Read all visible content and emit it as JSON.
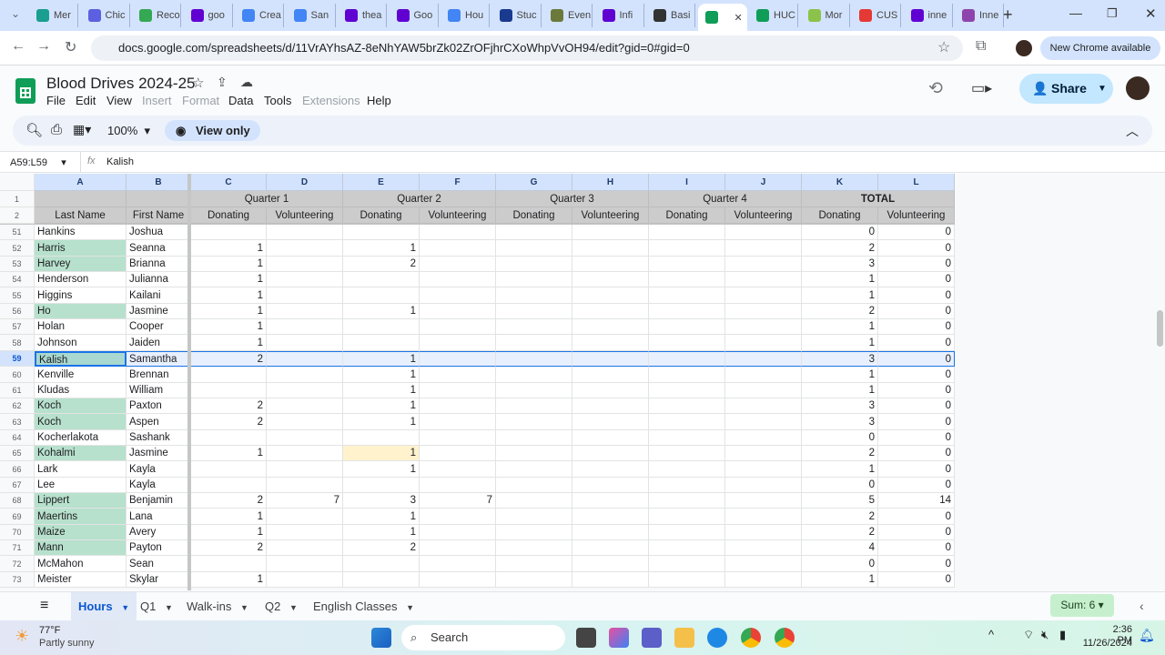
{
  "browser": {
    "tabs": [
      {
        "title": "Mer",
        "color": "#1a9e8f"
      },
      {
        "title": "Chic",
        "color": "#5b5fe0"
      },
      {
        "title": "Reco",
        "color": "#34a853"
      },
      {
        "title": "goo",
        "color": "#6001d2"
      },
      {
        "title": "Crea",
        "color": "#4285f4"
      },
      {
        "title": "San",
        "color": "#4285f4"
      },
      {
        "title": "thea",
        "color": "#6001d2"
      },
      {
        "title": "Goo",
        "color": "#6001d2"
      },
      {
        "title": "Hou",
        "color": "#4285f4"
      },
      {
        "title": "Stuc",
        "color": "#1a3a8f"
      },
      {
        "title": "Even",
        "color": "#6b7a3a"
      },
      {
        "title": "Infi",
        "color": "#6001d2"
      },
      {
        "title": "Basi",
        "color": "#333333"
      },
      {
        "title": "",
        "color": "#0f9d58",
        "active": true
      },
      {
        "title": "HUC",
        "color": "#0f9d58"
      },
      {
        "title": "Mor",
        "color": "#8bc34a"
      },
      {
        "title": "CUS",
        "color": "#e53935"
      },
      {
        "title": "inne",
        "color": "#6001d2"
      },
      {
        "title": "Inne",
        "color": "#8e44ad"
      }
    ],
    "url": "docs.google.com/spreadsheets/d/11VrAYhsAZ-8eNhYAW5brZk02ZrOFjhrCXoWhpVvOH94/edit?gid=0#gid=0",
    "new_chrome": "New Chrome available"
  },
  "sheet": {
    "title": "Blood Drives 2024-25",
    "menus": [
      {
        "label": "File",
        "disabled": false
      },
      {
        "label": "Edit",
        "disabled": false
      },
      {
        "label": "View",
        "disabled": false
      },
      {
        "label": "Insert",
        "disabled": true
      },
      {
        "label": "Format",
        "disabled": true
      },
      {
        "label": "Data",
        "disabled": false
      },
      {
        "label": "Tools",
        "disabled": false
      },
      {
        "label": "Extensions",
        "disabled": true
      },
      {
        "label": "Help",
        "disabled": false
      }
    ],
    "share": "Share",
    "zoom": "100%",
    "view_only": "View only",
    "name_box": "A59:L59",
    "formula_value": "Kalish",
    "columns": [
      "A",
      "B",
      "C",
      "D",
      "E",
      "F",
      "G",
      "H",
      "I",
      "J",
      "K",
      "L"
    ],
    "header_row1": {
      "quarters": [
        "Quarter 1",
        "Quarter 2",
        "Quarter 3",
        "Quarter 4",
        "TOTAL"
      ]
    },
    "header_row2": [
      "Last Name",
      "First Name",
      "Donating",
      "Volunteering",
      "Donating",
      "Volunteering",
      "Donating",
      "Volunteering",
      "Donating",
      "Volunteering",
      "Donating",
      "Volunteering"
    ],
    "highlight_green": "#b7e1cd",
    "highlight_yellow": "#fff2cc",
    "selected_row": 59,
    "rows": [
      {
        "n": "51",
        "c": [
          "Hankins",
          "Joshua",
          "",
          "",
          "",
          "",
          "",
          "",
          "",
          "",
          "0",
          "0"
        ]
      },
      {
        "n": "52",
        "c": [
          "Harris",
          "Seanna",
          "1",
          "",
          "1",
          "",
          "",
          "",
          "",
          "",
          "2",
          "0"
        ],
        "g": true
      },
      {
        "n": "53",
        "c": [
          "Harvey",
          "Brianna",
          "1",
          "",
          "2",
          "",
          "",
          "",
          "",
          "",
          "3",
          "0"
        ],
        "g": true
      },
      {
        "n": "54",
        "c": [
          "Henderson",
          "Julianna",
          "1",
          "",
          "",
          "",
          "",
          "",
          "",
          "",
          "1",
          "0"
        ]
      },
      {
        "n": "55",
        "c": [
          "Higgins",
          "Kailani",
          "1",
          "",
          "",
          "",
          "",
          "",
          "",
          "",
          "1",
          "0"
        ]
      },
      {
        "n": "56",
        "c": [
          "Ho",
          "Jasmine",
          "1",
          "",
          "1",
          "",
          "",
          "",
          "",
          "",
          "2",
          "0"
        ],
        "g": true
      },
      {
        "n": "57",
        "c": [
          "Holan",
          "Cooper",
          "1",
          "",
          "",
          "",
          "",
          "",
          "",
          "",
          "1",
          "0"
        ]
      },
      {
        "n": "58",
        "c": [
          "Johnson",
          "Jaiden",
          "1",
          "",
          "",
          "",
          "",
          "",
          "",
          "",
          "1",
          "0"
        ]
      },
      {
        "n": "59",
        "c": [
          "Kalish",
          "Samantha",
          "2",
          "",
          "1",
          "",
          "",
          "",
          "",
          "",
          "3",
          "0"
        ],
        "g": true
      },
      {
        "n": "60",
        "c": [
          "Kenville",
          "Brennan",
          "",
          "",
          "1",
          "",
          "",
          "",
          "",
          "",
          "1",
          "0"
        ]
      },
      {
        "n": "61",
        "c": [
          "Kludas",
          "William",
          "",
          "",
          "1",
          "",
          "",
          "",
          "",
          "",
          "1",
          "0"
        ]
      },
      {
        "n": "62",
        "c": [
          "Koch",
          "Paxton",
          "2",
          "",
          "1",
          "",
          "",
          "",
          "",
          "",
          "3",
          "0"
        ],
        "g": true
      },
      {
        "n": "63",
        "c": [
          "Koch",
          "Aspen",
          "2",
          "",
          "1",
          "",
          "",
          "",
          "",
          "",
          "3",
          "0"
        ],
        "g": true
      },
      {
        "n": "64",
        "c": [
          "Kocherlakota",
          "Sashank",
          "",
          "",
          "",
          "",
          "",
          "",
          "",
          "",
          "0",
          "0"
        ]
      },
      {
        "n": "65",
        "c": [
          "Kohalmi",
          "Jasmine",
          "1",
          "",
          "1",
          "",
          "",
          "",
          "",
          "",
          "2",
          "0"
        ],
        "g": true,
        "y": 4
      },
      {
        "n": "66",
        "c": [
          "Lark",
          "Kayla",
          "",
          "",
          "1",
          "",
          "",
          "",
          "",
          "",
          "1",
          "0"
        ]
      },
      {
        "n": "67",
        "c": [
          "Lee",
          "Kayla",
          "",
          "",
          "",
          "",
          "",
          "",
          "",
          "",
          "0",
          "0"
        ]
      },
      {
        "n": "68",
        "c": [
          "Lippert",
          "Benjamin",
          "2",
          "7",
          "3",
          "7",
          "",
          "",
          "",
          "",
          "5",
          "14"
        ],
        "g": true
      },
      {
        "n": "69",
        "c": [
          "Maertins",
          "Lana",
          "1",
          "",
          "1",
          "",
          "",
          "",
          "",
          "",
          "2",
          "0"
        ],
        "g": true
      },
      {
        "n": "70",
        "c": [
          "Maize",
          "Avery",
          "1",
          "",
          "1",
          "",
          "",
          "",
          "",
          "",
          "2",
          "0"
        ],
        "g": true
      },
      {
        "n": "71",
        "c": [
          "Mann",
          "Payton",
          "2",
          "",
          "2",
          "",
          "",
          "",
          "",
          "",
          "4",
          "0"
        ],
        "g": true
      },
      {
        "n": "72",
        "c": [
          "McMahon",
          "Sean",
          "",
          "",
          "",
          "",
          "",
          "",
          "",
          "",
          "0",
          "0"
        ]
      },
      {
        "n": "73",
        "c": [
          "Meister",
          "Skylar",
          "1",
          "",
          "",
          "",
          "",
          "",
          "",
          "",
          "1",
          "0"
        ]
      }
    ],
    "sheet_tabs": [
      {
        "label": "Hours",
        "active": true
      },
      {
        "label": "Q1"
      },
      {
        "label": "Walk-ins"
      },
      {
        "label": "Q2"
      },
      {
        "label": "English Classes"
      }
    ],
    "sum": "Sum: 6"
  },
  "taskbar": {
    "weather_temp": "77°F",
    "weather_desc": "Partly sunny",
    "search": "Search",
    "time": "2:36 PM",
    "date": "11/26/2024"
  }
}
